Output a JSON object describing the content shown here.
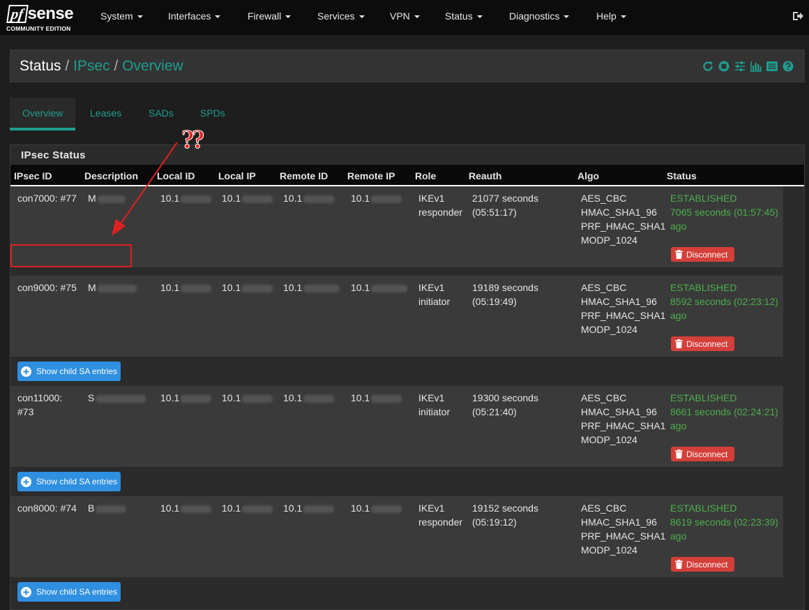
{
  "brand": {
    "logo_pf": "pf",
    "logo_sense": "sense",
    "subtitle": "COMMUNITY EDITION"
  },
  "nav": [
    {
      "label": "System"
    },
    {
      "label": "Interfaces"
    },
    {
      "label": "Firewall"
    },
    {
      "label": "Services"
    },
    {
      "label": "VPN"
    },
    {
      "label": "Status"
    },
    {
      "label": "Diagnostics"
    },
    {
      "label": "Help"
    }
  ],
  "breadcrumb": {
    "root": "Status",
    "sep": "/",
    "level1": "IPsec",
    "level2": "Overview"
  },
  "tabs": [
    {
      "label": "Overview"
    },
    {
      "label": "Leases"
    },
    {
      "label": "SADs"
    },
    {
      "label": "SPDs"
    }
  ],
  "panel": {
    "title": "IPsec Status"
  },
  "columns": [
    "IPsec ID",
    "Description",
    "Local ID",
    "Local IP",
    "Remote ID",
    "Remote IP",
    "Role",
    "Reauth",
    "Algo",
    "Status"
  ],
  "rows": [
    {
      "id": "con7000: #77",
      "desc": "M",
      "local_id": "10.1",
      "local_ip": "10.1",
      "remote_id": "10.1",
      "remote_ip": "10.1",
      "role1": "IKEv1",
      "role2": "responder",
      "reauth1": "21077 seconds",
      "reauth2": "(05:51:17)",
      "algo": [
        "AES_CBC",
        "HMAC_SHA1_96",
        "PRF_HMAC_SHA1",
        "MODP_1024"
      ],
      "status1": "ESTABLISHED",
      "status2": "7065 seconds (01:57:45)",
      "status3": "ago"
    },
    {
      "id": "con9000: #75",
      "desc": "M",
      "local_id": "10.1",
      "local_ip": "10.1",
      "remote_id": "10.1",
      "remote_ip": "10.1",
      "role1": "IKEv1",
      "role2": "initiator",
      "reauth1": "19189 seconds",
      "reauth2": "(05:19:49)",
      "algo": [
        "AES_CBC",
        "HMAC_SHA1_96",
        "PRF_HMAC_SHA1",
        "MODP_1024"
      ],
      "status1": "ESTABLISHED",
      "status2": "8592 seconds (02:23:12)",
      "status3": "ago"
    },
    {
      "id": "con11000:",
      "id2": "#73",
      "desc": "S",
      "local_id": "10.1",
      "local_ip": "10.1",
      "remote_id": "10.1",
      "remote_ip": "10.1",
      "role1": "IKEv1",
      "role2": "initiator",
      "reauth1": "19300 seconds",
      "reauth2": "(05:21:40)",
      "algo": [
        "AES_CBC",
        "HMAC_SHA1_96",
        "PRF_HMAC_SHA1",
        "MODP_1024"
      ],
      "status1": "ESTABLISHED",
      "status2": "8661 seconds (02:24:21)",
      "status3": "ago"
    },
    {
      "id": "con8000: #74",
      "desc": "B",
      "local_id": "10.1",
      "local_ip": "10.1",
      "remote_id": "10.1",
      "remote_ip": "10.1",
      "role1": "IKEv1",
      "role2": "responder",
      "reauth1": "19152 seconds",
      "reauth2": "(05:19:12)",
      "algo": [
        "AES_CBC",
        "HMAC_SHA1_96",
        "PRF_HMAC_SHA1",
        "MODP_1024"
      ],
      "status1": "ESTABLISHED",
      "status2": "8619 seconds (02:23:39)",
      "status3": "ago"
    }
  ],
  "buttons": {
    "disconnect": "Disconnect",
    "show_child": "Show child SA entries"
  },
  "annotation": {
    "text": "??"
  },
  "colors": {
    "accent": "#1e9d8f",
    "established": "#4cae4c",
    "danger": "#d43f3a",
    "info": "#2f8fe0",
    "annotation": "#e02020"
  },
  "icons": [
    "reload-icon",
    "stop-icon",
    "settings-sliders-icon",
    "bar-chart-icon",
    "log-list-icon",
    "help-icon",
    "logout-icon",
    "trash-icon",
    "plus-circle-icon"
  ]
}
